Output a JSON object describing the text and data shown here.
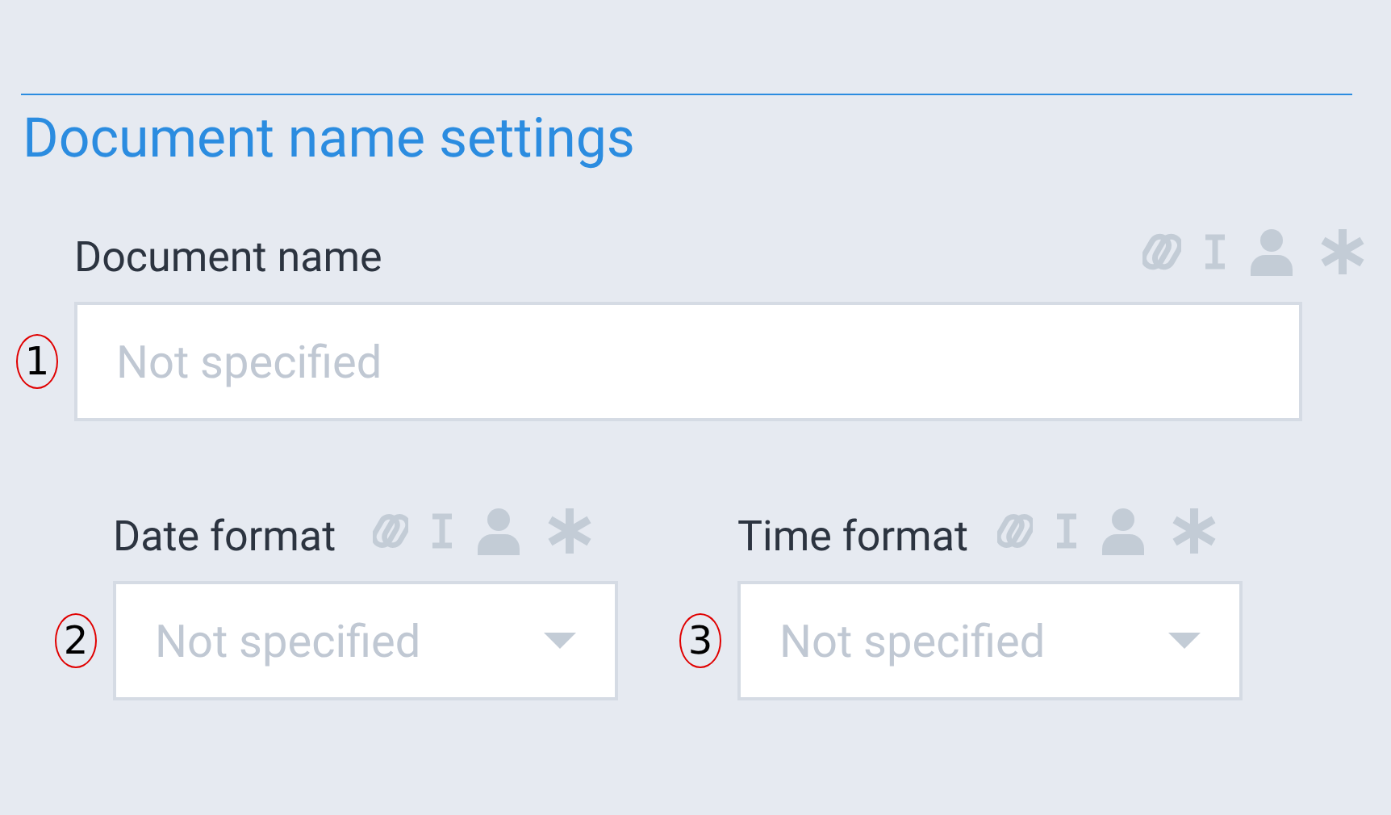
{
  "section": {
    "title": "Document name settings"
  },
  "fields": [
    {
      "label": "Document name",
      "placeholder": "Not specified",
      "kind": "text",
      "marker": "1"
    },
    {
      "label": "Date format",
      "placeholder": "Not specified",
      "kind": "select",
      "marker": "2"
    },
    {
      "label": "Time format",
      "placeholder": "Not specified",
      "kind": "select",
      "marker": "3"
    }
  ]
}
